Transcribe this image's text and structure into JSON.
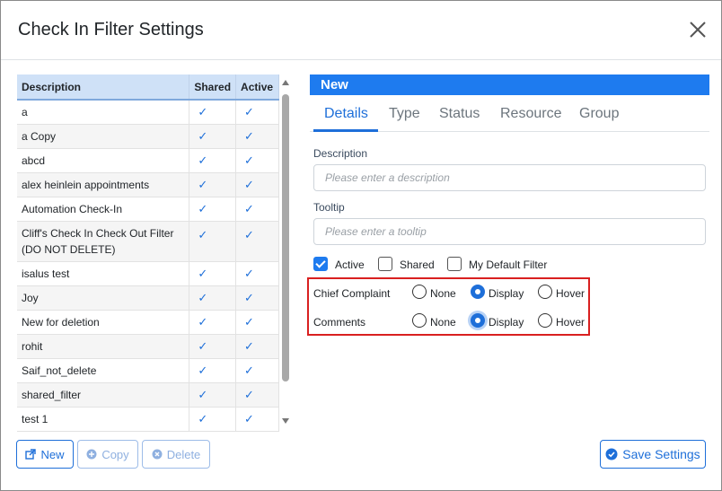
{
  "dialog": {
    "title": "Check In Filter Settings"
  },
  "list": {
    "columns": {
      "description": "Description",
      "shared": "Shared",
      "active": "Active"
    },
    "rows": [
      {
        "description": "a",
        "shared": "✓",
        "active": "✓"
      },
      {
        "description": "a Copy",
        "shared": "✓",
        "active": "✓"
      },
      {
        "description": "abcd",
        "shared": "✓",
        "active": "✓"
      },
      {
        "description": "alex heinlein appointments",
        "shared": "✓",
        "active": "✓"
      },
      {
        "description": "Automation Check-In",
        "shared": "✓",
        "active": "✓"
      },
      {
        "description": "Cliff's Check In Check Out Filter (DO NOT DELETE)",
        "shared": "✓",
        "active": "✓"
      },
      {
        "description": "isalus test",
        "shared": "✓",
        "active": "✓"
      },
      {
        "description": "Joy",
        "shared": "✓",
        "active": "✓"
      },
      {
        "description": "New for deletion",
        "shared": "✓",
        "active": "✓"
      },
      {
        "description": "rohit",
        "shared": "✓",
        "active": "✓"
      },
      {
        "description": "Saif_not_delete",
        "shared": "✓",
        "active": "✓"
      },
      {
        "description": "shared_filter",
        "shared": "✓",
        "active": "✓"
      },
      {
        "description": "test 1",
        "shared": "✓",
        "active": "✓"
      }
    ]
  },
  "buttons": {
    "new": "New",
    "copy": "Copy",
    "delete": "Delete",
    "save": "Save Settings"
  },
  "panel": {
    "header": "New",
    "tabs": [
      "Details",
      "Type",
      "Status",
      "Resource",
      "Group"
    ],
    "description_label": "Description",
    "description_placeholder": "Please enter a description",
    "tooltip_label": "Tooltip",
    "tooltip_placeholder": "Please enter a tooltip",
    "checkboxes": {
      "active": "Active",
      "shared": "Shared",
      "default": "My Default Filter"
    },
    "checkbox_states": {
      "active": true,
      "shared": false,
      "default": false
    },
    "chief_complaint": {
      "label": "Chief Complaint",
      "options": [
        "None",
        "Display",
        "Hover"
      ],
      "selected": "Display"
    },
    "comments": {
      "label": "Comments",
      "options": [
        "None",
        "Display",
        "Hover"
      ],
      "selected": "Display"
    }
  },
  "colors": {
    "accent": "#1e7bef",
    "highlight_border": "#d92020",
    "header_row": "#cfe1f7"
  }
}
